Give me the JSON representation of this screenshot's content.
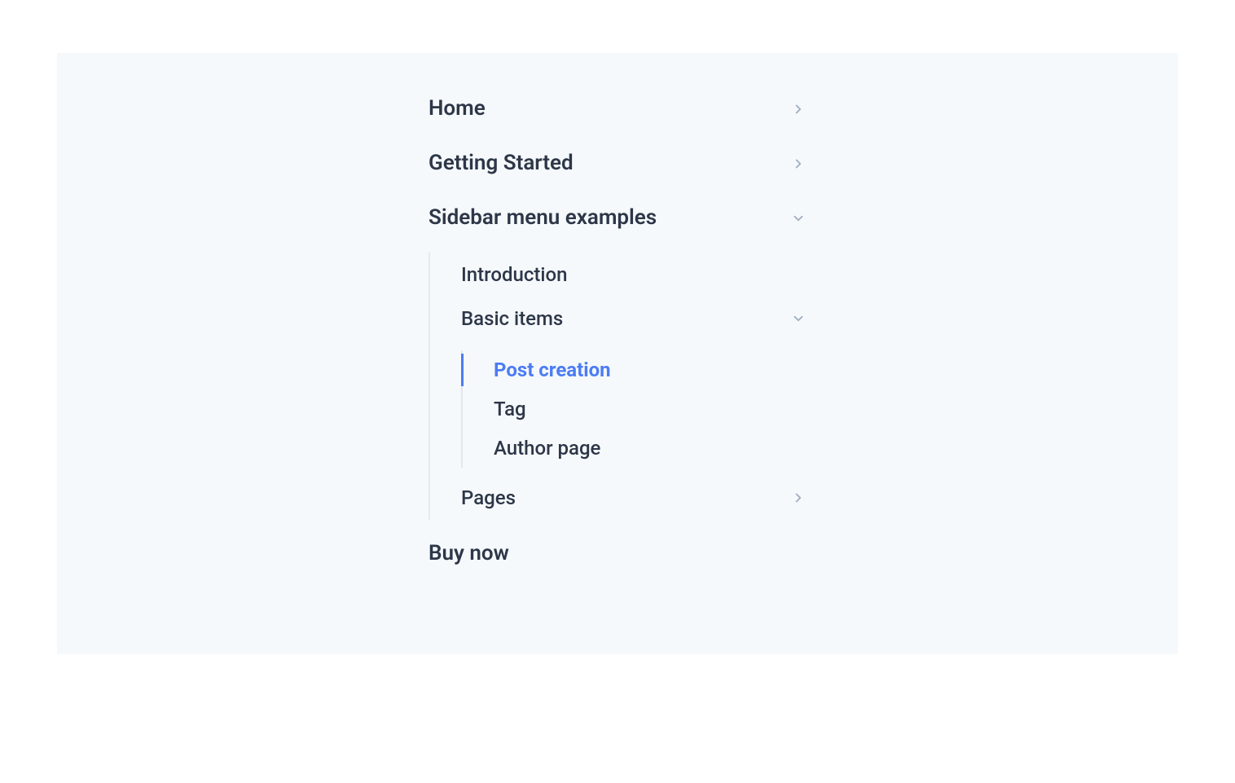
{
  "menu": {
    "items": [
      {
        "label": "Home",
        "expandable": true,
        "expanded": false
      },
      {
        "label": "Getting Started",
        "expandable": true,
        "expanded": false
      },
      {
        "label": "Sidebar menu examples",
        "expandable": true,
        "expanded": true,
        "children": [
          {
            "label": "Introduction",
            "expandable": false
          },
          {
            "label": "Basic items",
            "expandable": true,
            "expanded": true,
            "children": [
              {
                "label": "Post creation",
                "active": true
              },
              {
                "label": "Tag",
                "active": false
              },
              {
                "label": "Author page",
                "active": false
              }
            ]
          },
          {
            "label": "Pages",
            "expandable": true,
            "expanded": false
          }
        ]
      },
      {
        "label": "Buy now",
        "expandable": false
      }
    ]
  },
  "colors": {
    "background": "#f6f9fc",
    "text_primary": "#2d3748",
    "accent": "#4c7cf3",
    "border": "#e2e8f0",
    "chevron": "#a0aec0"
  }
}
